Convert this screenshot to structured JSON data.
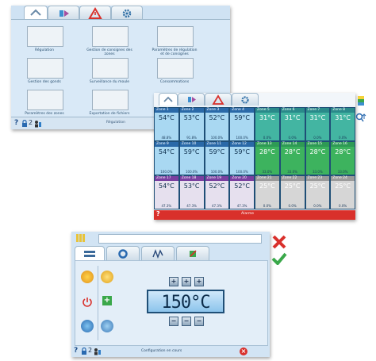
{
  "colors": {
    "panel_bg": "#cfe2f3",
    "accent_red": "#d9302b",
    "accent_green": "#3aa84a",
    "lcd_blue": "#2b6fa6"
  },
  "status_bar": {
    "count": "2"
  },
  "home": {
    "tiles": [
      {
        "label": "Régulation"
      },
      {
        "label": "Gestion de consignes des zones"
      },
      {
        "label": "Paramètres de régulation et de consignes"
      },
      {
        "label": "Gestion des gonds"
      },
      {
        "label": "Surveillance du moule"
      },
      {
        "label": "Consommations"
      },
      {
        "label": "Paramètres des zones"
      },
      {
        "label": "Exportation de fichiers"
      }
    ],
    "footer_label": "Régulation"
  },
  "zones": {
    "rows": [
      [
        {
          "name": "Zone 1",
          "temp": "54°C",
          "pct": "48.8%"
        },
        {
          "name": "Zone 2",
          "temp": "53°C",
          "pct": "91.8%"
        },
        {
          "name": "Zone 3",
          "temp": "52°C",
          "pct": "100.0%"
        },
        {
          "name": "Zone 4",
          "temp": "59°C",
          "pct": "100.0%"
        },
        {
          "name": "Zone 5",
          "temp": "31°C",
          "pct": "0.0%"
        },
        {
          "name": "Zone 6",
          "temp": "31°C",
          "pct": "0.0%"
        },
        {
          "name": "Zone 7",
          "temp": "31°C",
          "pct": "0.0%"
        },
        {
          "name": "Zone 8",
          "temp": "31°C",
          "pct": "0.0%"
        }
      ],
      [
        {
          "name": "Zone 9",
          "temp": "54°C",
          "pct": "100.0%"
        },
        {
          "name": "Zone 10",
          "temp": "59°C",
          "pct": "100.0%"
        },
        {
          "name": "Zone 11",
          "temp": "59°C",
          "pct": "100.0%"
        },
        {
          "name": "Zone 12",
          "temp": "59°C",
          "pct": "100.0%"
        },
        {
          "name": "Zone 13",
          "temp": "28°C",
          "pct": "33.0%"
        },
        {
          "name": "Zone 14",
          "temp": "28°C",
          "pct": "33.0%"
        },
        {
          "name": "Zone 15",
          "temp": "28°C",
          "pct": "33.0%"
        },
        {
          "name": "Zone 16",
          "temp": "28°C",
          "pct": "33.0%"
        }
      ],
      [
        {
          "name": "Zone 17",
          "temp": "54°C",
          "pct": "47.3%"
        },
        {
          "name": "Zone 18",
          "temp": "53°C",
          "pct": "47.3%"
        },
        {
          "name": "Zone 19",
          "temp": "52°C",
          "pct": "47.3%"
        },
        {
          "name": "Zone 20",
          "temp": "52°C",
          "pct": "47.3%"
        },
        {
          "name": "Zone 21",
          "temp": "25°C",
          "pct": "0.0%"
        },
        {
          "name": "Zone 22",
          "temp": "25°C",
          "pct": "0.0%"
        },
        {
          "name": "Zone 23",
          "temp": "25°C",
          "pct": "0.0%"
        },
        {
          "name": "Zone 24",
          "temp": "25°C",
          "pct": "0.0%"
        }
      ]
    ],
    "row_colors": [
      [
        "#a9d8f2",
        "#a9d8f2",
        "#a9d8f2",
        "#a9d8f2",
        "#43b5a2",
        "#43b5a2",
        "#43b5a2",
        "#43b5a2"
      ],
      [
        "#a9d8f2",
        "#a9d8f2",
        "#a9d8f2",
        "#a9d8f2",
        "#3db35e",
        "#3db35e",
        "#3db35e",
        "#3db35e"
      ],
      [
        "#e6e0ee",
        "#e6e0ee",
        "#e6e0ee",
        "#e6e0ee",
        "#d6d6d6",
        "#d6d6d6",
        "#d6d6d6",
        "#d6d6d6"
      ]
    ],
    "header_colors": [
      "#2a69a8",
      "#2a69a8",
      "#7a3fa0"
    ],
    "header_colors_right": [
      "#2a8a8a",
      "#2e9a55",
      "#9a9a9a"
    ],
    "alarm_label": "Alarme"
  },
  "setpoint": {
    "search_value": "",
    "lcd_value": "150°C",
    "status_text": "Configuration en cours",
    "count": "2"
  }
}
